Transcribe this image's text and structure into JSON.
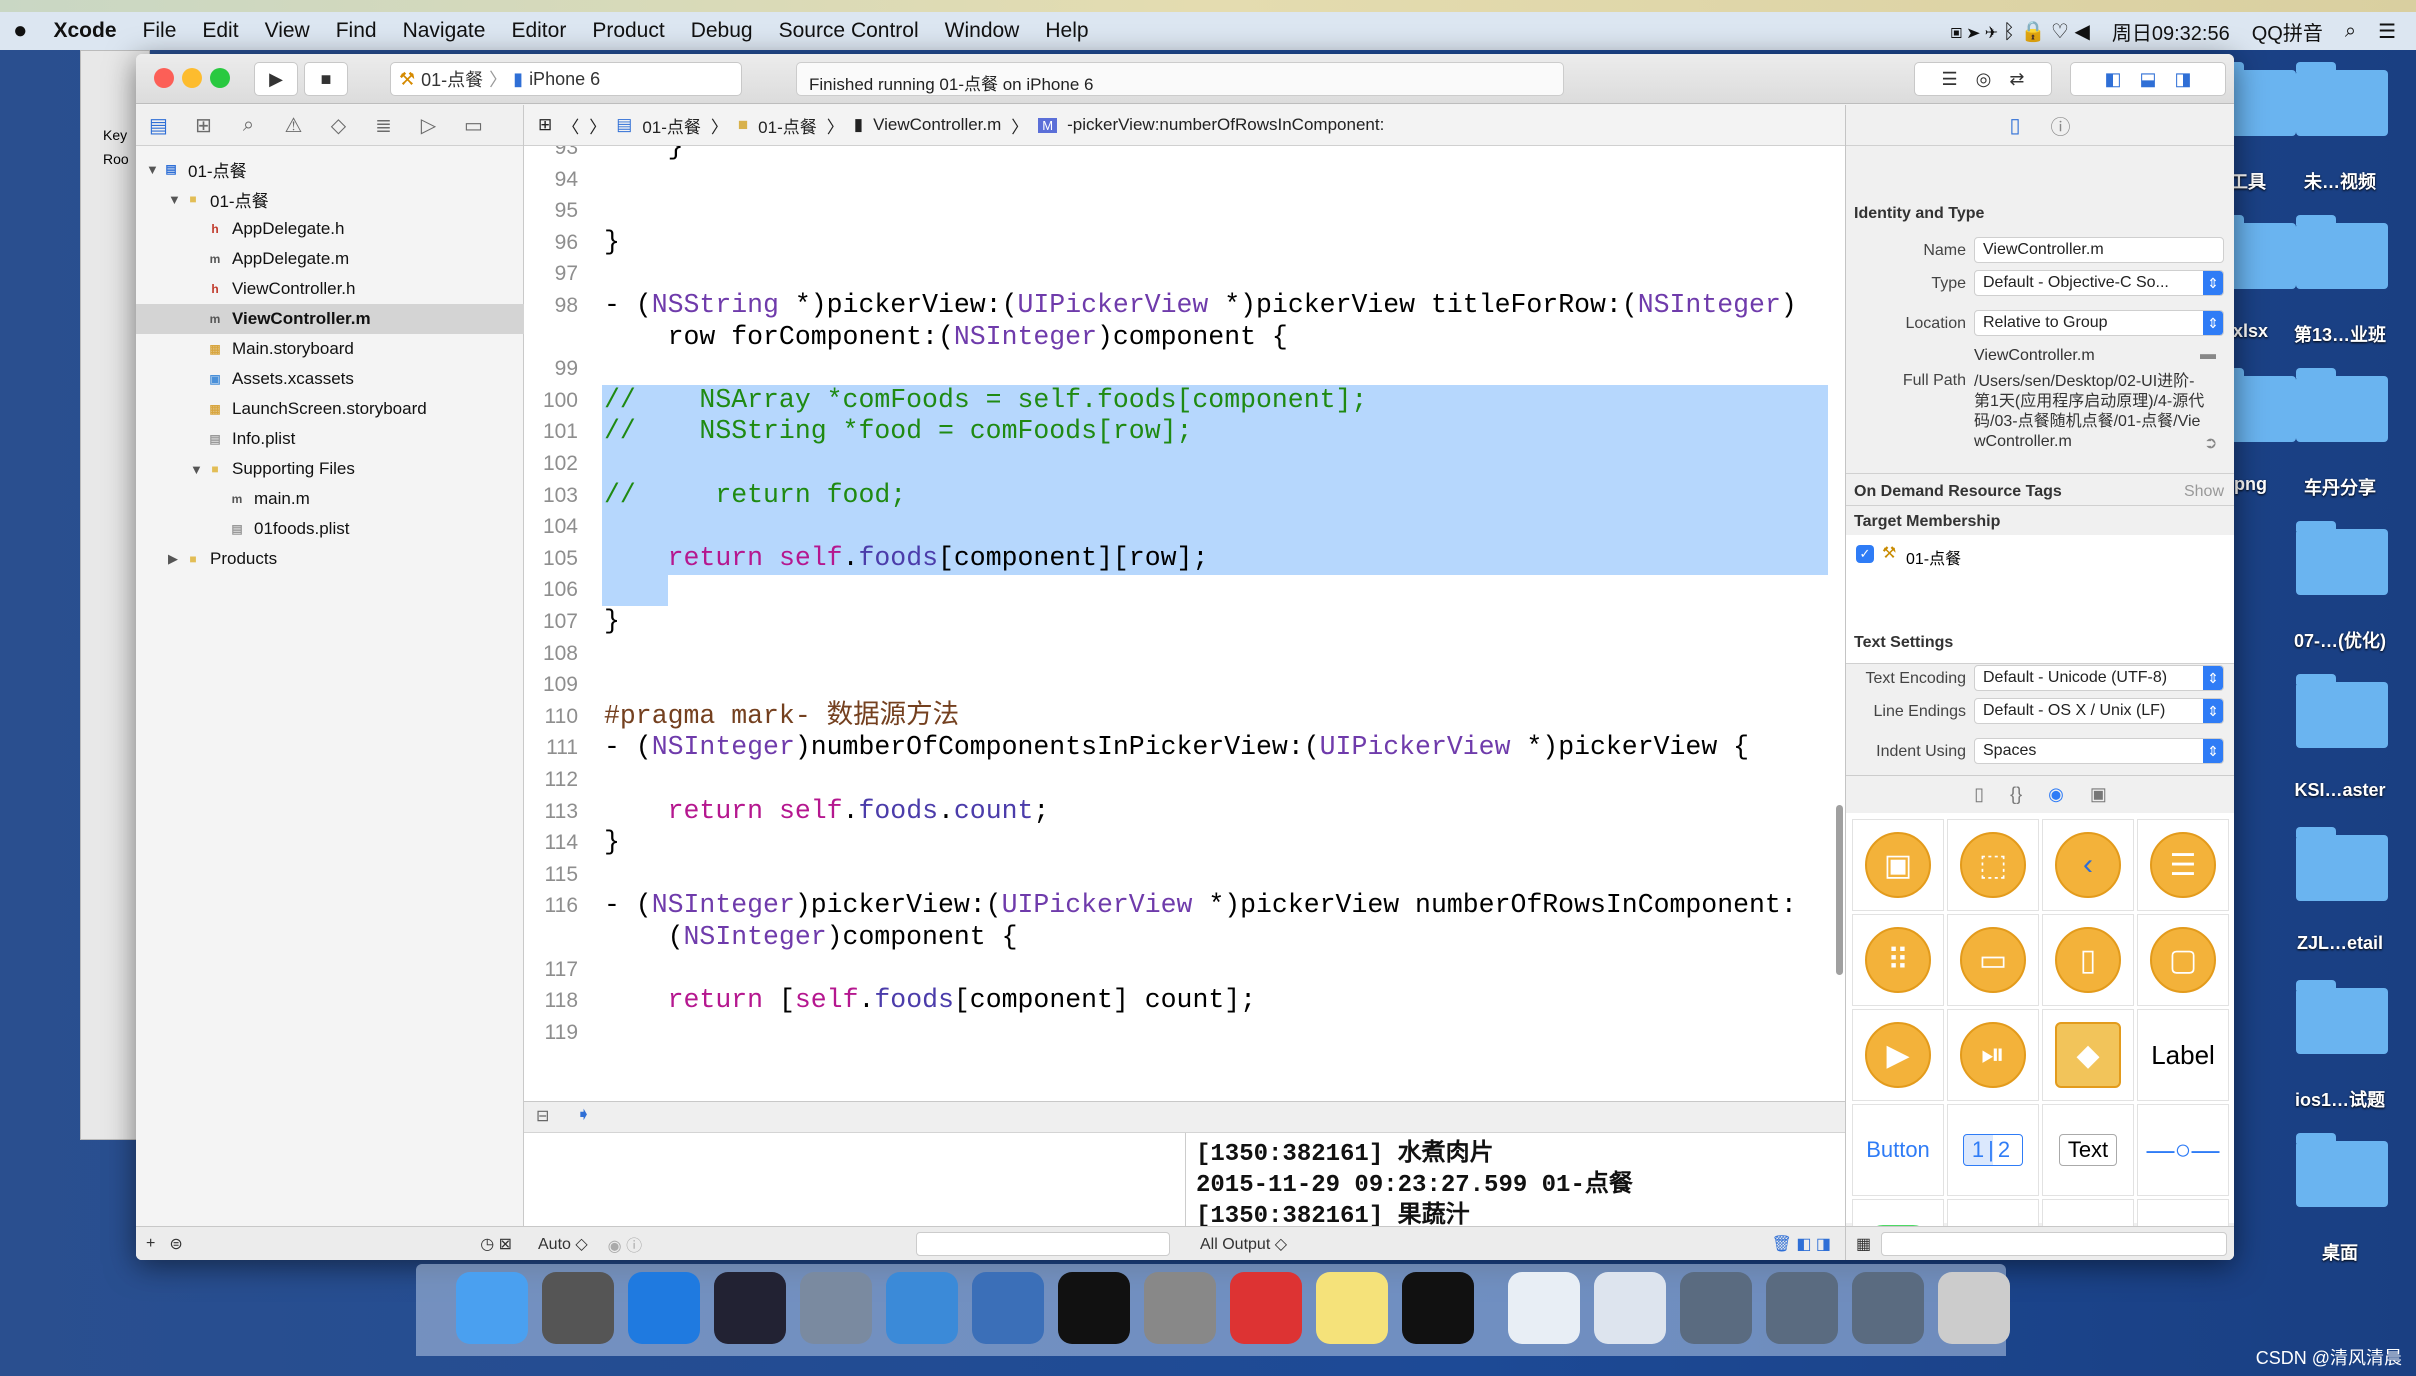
{
  "menubar": {
    "apple": "",
    "items": [
      "Xcode",
      "File",
      "Edit",
      "View",
      "Find",
      "Navigate",
      "Editor",
      "Product",
      "Debug",
      "Source Control",
      "Window",
      "Help"
    ],
    "clock": "周日09:32:56",
    "ime": "QQ拼音"
  },
  "bgwindow": {
    "labels": [
      "Key",
      "Roo"
    ]
  },
  "toolbar": {
    "scheme": "01-点餐",
    "device": "iPhone 6",
    "status": "Finished running 01-点餐 on iPhone 6"
  },
  "navigator": {
    "tree": [
      {
        "label": "01-点餐",
        "depth": 0,
        "icon": "project-icon",
        "open": true
      },
      {
        "label": "01-点餐",
        "depth": 1,
        "icon": "folder-icon",
        "open": true
      },
      {
        "label": "AppDelegate.h",
        "depth": 2,
        "icon": "h-file-icon"
      },
      {
        "label": "AppDelegate.m",
        "depth": 2,
        "icon": "m-file-icon"
      },
      {
        "label": "ViewController.h",
        "depth": 2,
        "icon": "h-file-icon"
      },
      {
        "label": "ViewController.m",
        "depth": 2,
        "icon": "m-file-icon",
        "selected": true
      },
      {
        "label": "Main.storyboard",
        "depth": 2,
        "icon": "storyboard-icon"
      },
      {
        "label": "Assets.xcassets",
        "depth": 2,
        "icon": "assets-icon"
      },
      {
        "label": "LaunchScreen.storyboard",
        "depth": 2,
        "icon": "storyboard-icon"
      },
      {
        "label": "Info.plist",
        "depth": 2,
        "icon": "plist-icon"
      },
      {
        "label": "Supporting Files",
        "depth": 2,
        "icon": "folder-icon",
        "open": true
      },
      {
        "label": "main.m",
        "depth": 3,
        "icon": "m-file-icon"
      },
      {
        "label": "01foods.plist",
        "depth": 3,
        "icon": "plist-icon"
      },
      {
        "label": "Products",
        "depth": 1,
        "icon": "folder-icon",
        "open": false
      }
    ]
  },
  "jumpbar": [
    "01-点餐",
    "01-点餐",
    "ViewController.m",
    "-pickerView:numberOfRowsInComponent:"
  ],
  "code": [
    {
      "n": "93",
      "segs": [
        [
          "",
          "    }"
        ]
      ]
    },
    {
      "n": "94",
      "segs": []
    },
    {
      "n": "95",
      "segs": []
    },
    {
      "n": "96",
      "segs": [
        [
          "",
          "}"
        ]
      ]
    },
    {
      "n": "97",
      "segs": []
    },
    {
      "n": "98",
      "segs": [
        [
          "",
          "- ("
        ],
        [
          "type",
          "NSString"
        ],
        [
          "",
          " *)pickerView:("
        ],
        [
          "type",
          "UIPickerView"
        ],
        [
          "",
          " *)pickerView titleForRow:("
        ],
        [
          "type",
          "NSInteger"
        ],
        [
          "",
          ")"
        ]
      ]
    },
    {
      "n": "",
      "segs": [
        [
          "",
          "    row forComponent:("
        ],
        [
          "type",
          "NSInteger"
        ],
        [
          "",
          ")component {"
        ]
      ]
    },
    {
      "n": "99",
      "segs": []
    },
    {
      "n": "100",
      "segs": [
        [
          "com",
          "//    NSArray *comFoods = self.foods[component];"
        ]
      ],
      "sel": true
    },
    {
      "n": "101",
      "segs": [
        [
          "com",
          "//    NSString *food = comFoods[row];"
        ]
      ],
      "sel": true
    },
    {
      "n": "102",
      "segs": [],
      "sel": true
    },
    {
      "n": "103",
      "segs": [
        [
          "com",
          "//     return food;"
        ]
      ],
      "sel": true
    },
    {
      "n": "104",
      "segs": [],
      "sel": true
    },
    {
      "n": "105",
      "segs": [
        [
          "",
          "    "
        ],
        [
          "kw",
          "return"
        ],
        [
          "",
          " "
        ],
        [
          "kw",
          "self"
        ],
        [
          "",
          "."
        ],
        [
          "prop",
          "foods"
        ],
        [
          "",
          "[component][row];"
        ]
      ],
      "sel": true
    },
    {
      "n": "106",
      "segs": [],
      "selpart": true
    },
    {
      "n": "107",
      "segs": [
        [
          "",
          "}"
        ]
      ]
    },
    {
      "n": "108",
      "segs": []
    },
    {
      "n": "109",
      "segs": []
    },
    {
      "n": "110",
      "segs": [
        [
          "pre",
          "#pragma mark- 数据源方法"
        ]
      ]
    },
    {
      "n": "111",
      "segs": [
        [
          "",
          "- ("
        ],
        [
          "type",
          "NSInteger"
        ],
        [
          "",
          ")numberOfComponentsInPickerView:("
        ],
        [
          "type",
          "UIPickerView"
        ],
        [
          "",
          " *)pickerView {"
        ]
      ]
    },
    {
      "n": "112",
      "segs": []
    },
    {
      "n": "113",
      "segs": [
        [
          "",
          "    "
        ],
        [
          "kw",
          "return"
        ],
        [
          "",
          " "
        ],
        [
          "kw",
          "self"
        ],
        [
          "",
          "."
        ],
        [
          "prop",
          "foods"
        ],
        [
          "",
          "."
        ],
        [
          "prop",
          "count"
        ],
        [
          "",
          ";"
        ]
      ]
    },
    {
      "n": "114",
      "segs": [
        [
          "",
          "}"
        ]
      ]
    },
    {
      "n": "115",
      "segs": []
    },
    {
      "n": "116",
      "segs": [
        [
          "",
          "- ("
        ],
        [
          "type",
          "NSInteger"
        ],
        [
          "",
          ")pickerView:("
        ],
        [
          "type",
          "UIPickerView"
        ],
        [
          "",
          " *)pickerView numberOfRowsInComponent:"
        ]
      ]
    },
    {
      "n": "",
      "segs": [
        [
          "",
          "    ("
        ],
        [
          "type",
          "NSInteger"
        ],
        [
          "",
          ")component {"
        ]
      ]
    },
    {
      "n": "117",
      "segs": []
    },
    {
      "n": "118",
      "segs": [
        [
          "",
          "    "
        ],
        [
          "kw",
          "return"
        ],
        [
          "",
          " ["
        ],
        [
          "kw",
          "self"
        ],
        [
          "",
          "."
        ],
        [
          "prop",
          "foods"
        ],
        [
          "",
          "[component] count];"
        ]
      ]
    },
    {
      "n": "119",
      "segs": []
    }
  ],
  "debug": {
    "console": "[1350:382161] 水煮肉片\n2015-11-29 09:23:27.599 01-点餐\n[1350:382161] 果蔬汁",
    "auto": "Auto ◇",
    "output": "All Output ◇"
  },
  "inspector": {
    "identity_title": "Identity and Type",
    "name_label": "Name",
    "name_value": "ViewController.m",
    "type_label": "Type",
    "type_value": "Default - Objective-C So...",
    "location_label": "Location",
    "location_value": "Relative to Group",
    "location_file": "ViewController.m",
    "fullpath_label": "Full Path",
    "fullpath_value": "/Users/sen/Desktop/02-UI进阶-第1天(应用程序启动原理)/4-源代码/03-点餐随机点餐/01-点餐/ViewController.m",
    "ondemand_title": "On Demand Resource Tags",
    "show_label": "Show",
    "target_title": "Target Membership",
    "target_name": "01-点餐",
    "target_checked": true,
    "text_title": "Text Settings",
    "encoding_label": "Text Encoding",
    "encoding_value": "Default - Unicode (UTF-8)",
    "endings_label": "Line Endings",
    "endings_value": "Default - OS X / Unix (LF)",
    "indent_label": "Indent Using",
    "indent_value": "Spaces"
  },
  "library": [
    {
      "icon": "view-controller-icon",
      "g": "▣"
    },
    {
      "icon": "storyboard-reference-icon",
      "g": "⬚"
    },
    {
      "icon": "navigation-controller-icon",
      "g": "‹"
    },
    {
      "icon": "table-view-controller-icon",
      "g": "☰"
    },
    {
      "icon": "collection-view-controller-icon",
      "g": "⠿"
    },
    {
      "icon": "tab-bar-controller-icon",
      "g": "▭"
    },
    {
      "icon": "page-view-controller-icon",
      "g": "▯"
    },
    {
      "icon": "glkit-view-controller-icon",
      "g": "▢"
    },
    {
      "icon": "av-player-view-controller-icon",
      "g": "▶"
    },
    {
      "icon": "media-player-icon",
      "g": "⏯"
    },
    {
      "icon": "object-cube-icon",
      "g": "◆"
    },
    {
      "text": "Label",
      "icon": "label-object"
    },
    {
      "text": "Button",
      "icon": "button-object"
    },
    {
      "text": "1|2",
      "icon": "segmented-control-object"
    },
    {
      "text": "Text",
      "icon": "text-field-object"
    },
    {
      "icon": "slider-icon",
      "g": "—○—"
    },
    {
      "icon": "switch-icon",
      "g": "●"
    },
    {
      "icon": "activity-indicator-icon",
      "g": "✺"
    },
    {
      "icon": "progress-view-icon",
      "g": "▬"
    },
    {
      "icon": "stepper-icon",
      "g": "···"
    }
  ],
  "colors": {
    "accent": "#2f7cf6",
    "selection": "#b6d7fd",
    "comment": "#1f8a12",
    "keyword": "#b5178f",
    "type": "#6f3bab",
    "library_orange": "#f3b23a"
  },
  "dock": [
    "finder",
    "launchpad",
    "safari",
    "mouse",
    "photo-booth",
    "xcode",
    "instruments",
    "terminal",
    "system-preferences",
    "wps",
    "notes",
    "console",
    "preview-doc",
    "screenshot",
    "monitor-1",
    "monitor-2",
    "monitor-3",
    "trash"
  ],
  "desktop": [
    {
      "label": "工具",
      "col": 0
    },
    {
      "label": "未…视频",
      "col": 1,
      "tag": true
    },
    {
      "label": ".xlsx",
      "col": 0
    },
    {
      "label": "第13…业班",
      "col": 1
    },
    {
      "label": ".png",
      "col": 0
    },
    {
      "label": "车丹分享",
      "col": 1
    },
    {
      "label": "07-…(优化)",
      "col": 1
    },
    {
      "label": "KSI…aster",
      "col": 1
    },
    {
      "label": "ZJL…etail",
      "col": 1
    },
    {
      "label": "ios1…试题",
      "col": 1
    },
    {
      "label": "桌面",
      "col": 1
    }
  ],
  "watermark": "CSDN @清风清晨"
}
